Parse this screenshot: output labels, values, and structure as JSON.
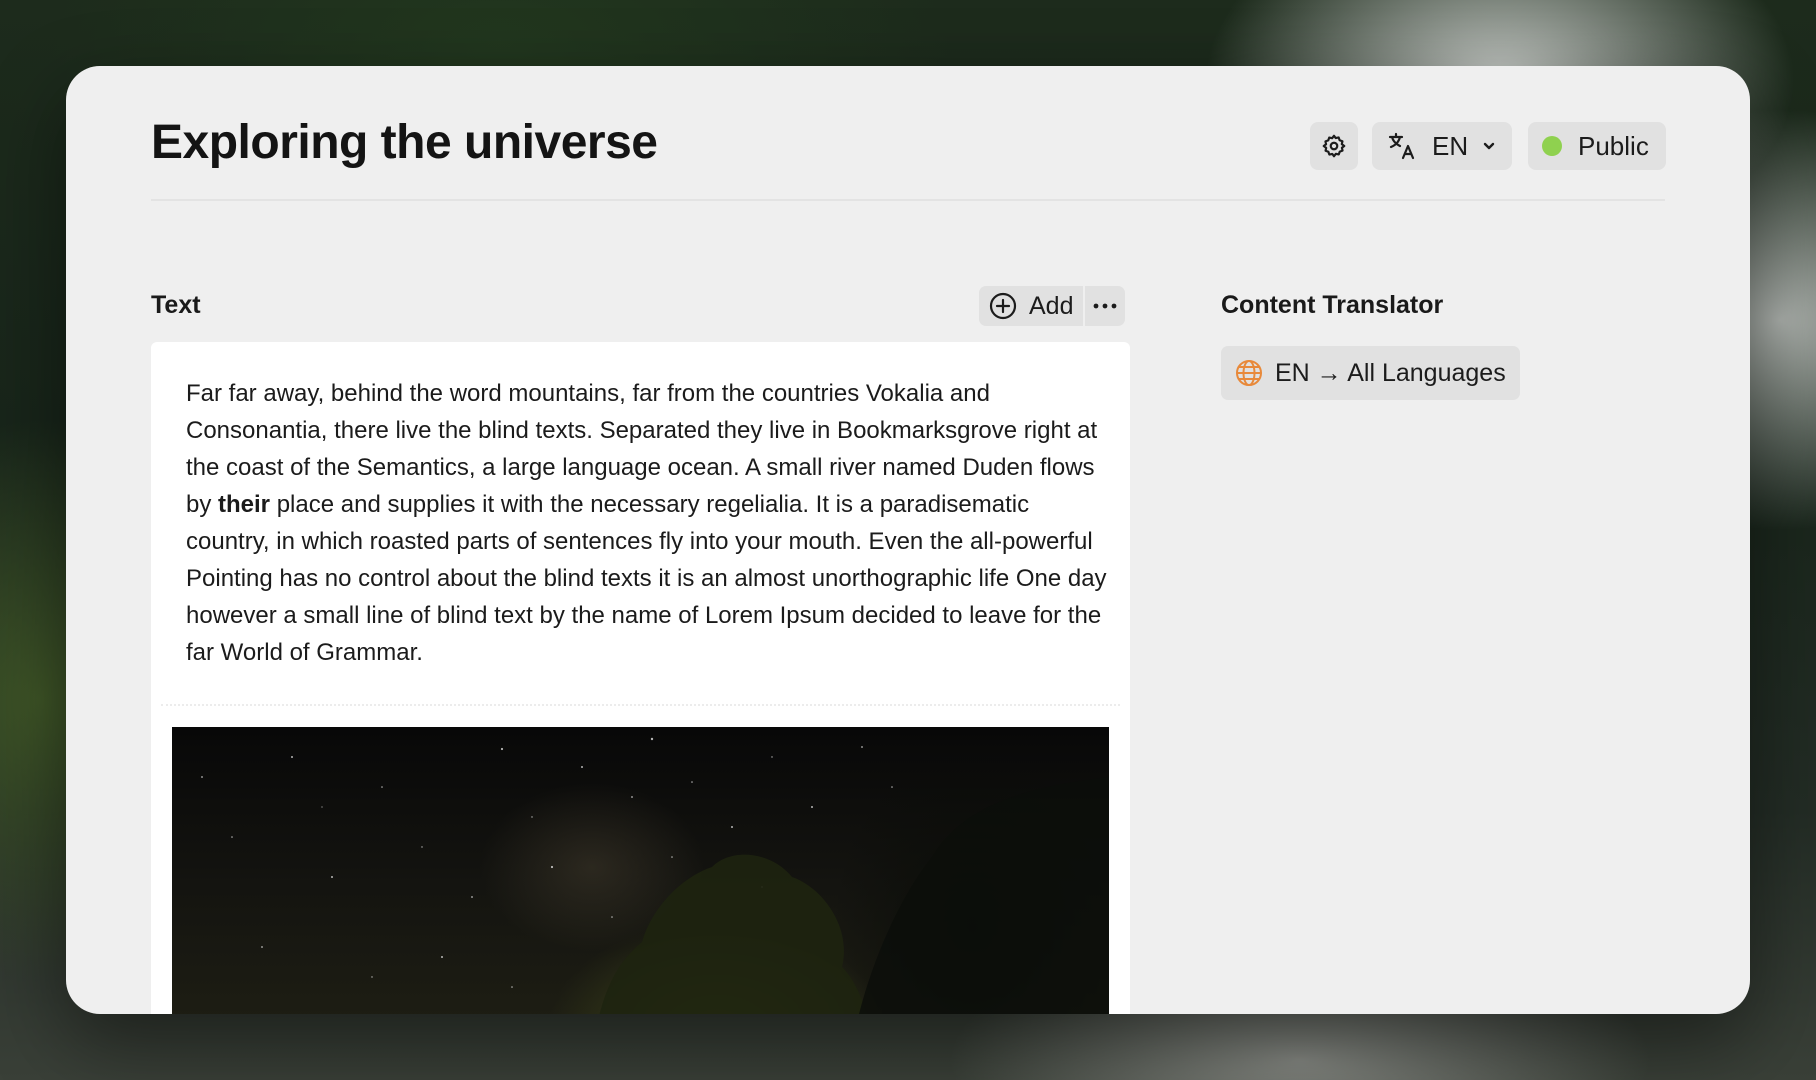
{
  "page": {
    "title": "Exploring the universe"
  },
  "header": {
    "language": "EN",
    "visibility": "Public",
    "visibility_color": "#8fd14f"
  },
  "text_section": {
    "label": "Text",
    "add_label": "Add",
    "body_before": "Far far away, behind the word mountains, far from the countries Vokalia and Consonantia, there live the blind texts. Separated they live in Bookmarksgrove right at the coast of the Semantics, a large language ocean. A small river named Duden flows by ",
    "body_bold": "their",
    "body_after": " place and supplies it with the necessary regelialia. It is a paradisematic country, in which roasted parts of sentences fly into your mouth. Even the all-powerful Pointing has no control about the blind texts it is an almost unorthographic life One day however a small line of blind text by the name of Lorem Ipsum decided to leave for the far World of Grammar."
  },
  "translator": {
    "label": "Content Translator",
    "chip_label": "EN → All Languages",
    "accent_color": "#e8893a"
  },
  "icons": {
    "settings": "gear-icon",
    "language": "translate-icon",
    "dropdown": "chevron-down-icon",
    "add": "plus-circle-icon",
    "more": "more-horizontal-icon",
    "translator": "globe-icon"
  }
}
